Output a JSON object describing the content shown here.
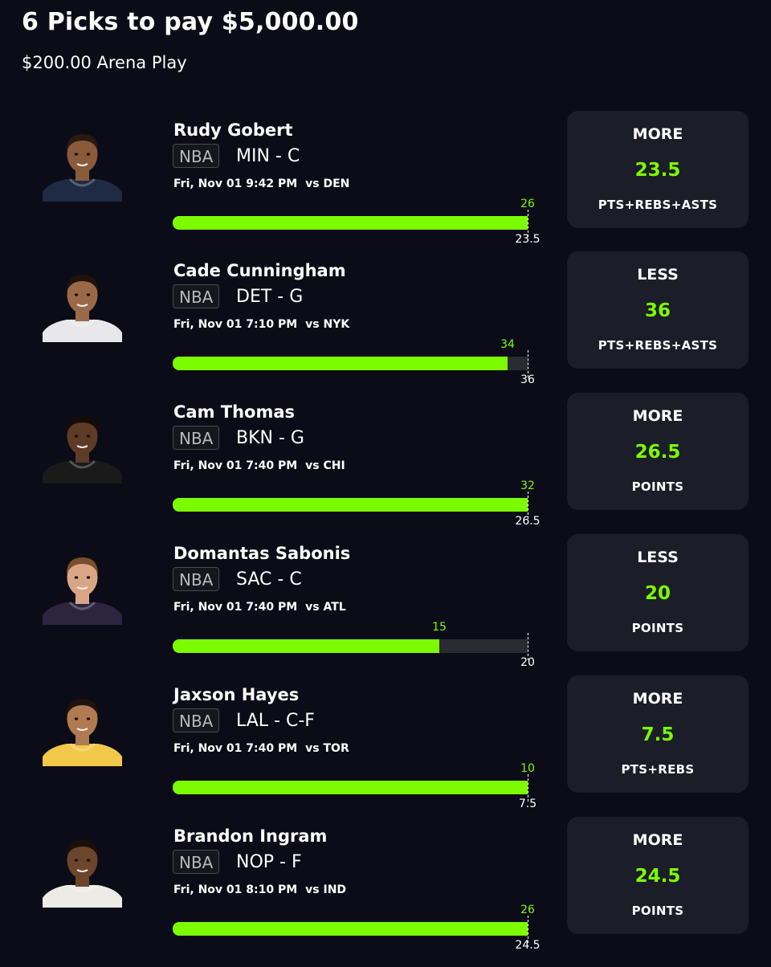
{
  "header": {
    "title": "6 Picks to pay $5,000.00",
    "subtitle": "$200.00 Arena Play"
  },
  "colors": {
    "background": "#0b0c17",
    "card": "#1b1d29",
    "accent_green": "#7cfc00",
    "track": "#2a2b33"
  },
  "picks": [
    {
      "name": "Rudy Gobert",
      "league": "NBA",
      "team_pos": "MIN - C",
      "game_time": "Fri, Nov 01 9:42 PM",
      "opponent": "vs DEN",
      "direction": "MORE",
      "line": "23.5",
      "stat": "PTS+REBS+ASTS",
      "actual": "26",
      "target": "23.5",
      "progress": 1.0,
      "jersey_color": "#1f2a44",
      "skin": "#8a5a3c",
      "hair": "#2a1a10"
    },
    {
      "name": "Cade Cunningham",
      "league": "NBA",
      "team_pos": "DET - G",
      "game_time": "Fri, Nov 01 7:10 PM",
      "opponent": "vs NYK",
      "direction": "LESS",
      "line": "36",
      "stat": "PTS+REBS+ASTS",
      "actual": "34",
      "target": "36",
      "progress": 0.944,
      "jersey_color": "#e8e8ec",
      "skin": "#9a6a48",
      "hair": "#1e140c"
    },
    {
      "name": "Cam Thomas",
      "league": "NBA",
      "team_pos": "BKN - G",
      "game_time": "Fri, Nov 01 7:40 PM",
      "opponent": "vs CHI",
      "direction": "MORE",
      "line": "26.5",
      "stat": "POINTS",
      "actual": "32",
      "target": "26.5",
      "progress": 1.0,
      "jersey_color": "#1a1a1a",
      "skin": "#5e3b26",
      "hair": "#140c08"
    },
    {
      "name": "Domantas Sabonis",
      "league": "NBA",
      "team_pos": "SAC - C",
      "game_time": "Fri, Nov 01 7:40 PM",
      "opponent": "vs ATL",
      "direction": "LESS",
      "line": "20",
      "stat": "POINTS",
      "actual": "15",
      "target": "20",
      "progress": 0.75,
      "jersey_color": "#2d2440",
      "skin": "#d9a584",
      "hair": "#7a4e2a"
    },
    {
      "name": "Jaxson Hayes",
      "league": "NBA",
      "team_pos": "LAL - C-F",
      "game_time": "Fri, Nov 01 7:40 PM",
      "opponent": "vs TOR",
      "direction": "MORE",
      "line": "7.5",
      "stat": "PTS+REBS",
      "actual": "10",
      "target": "7.5",
      "progress": 1.0,
      "jersey_color": "#f2c84b",
      "skin": "#b07a52",
      "hair": "#1e140c"
    },
    {
      "name": "Brandon Ingram",
      "league": "NBA",
      "team_pos": "NOP - F",
      "game_time": "Fri, Nov 01 8:10 PM",
      "opponent": "vs IND",
      "direction": "MORE",
      "line": "24.5",
      "stat": "POINTS",
      "actual": "26",
      "target": "24.5",
      "progress": 1.0,
      "jersey_color": "#ecebe6",
      "skin": "#6b452c",
      "hair": "#1a100a"
    }
  ]
}
